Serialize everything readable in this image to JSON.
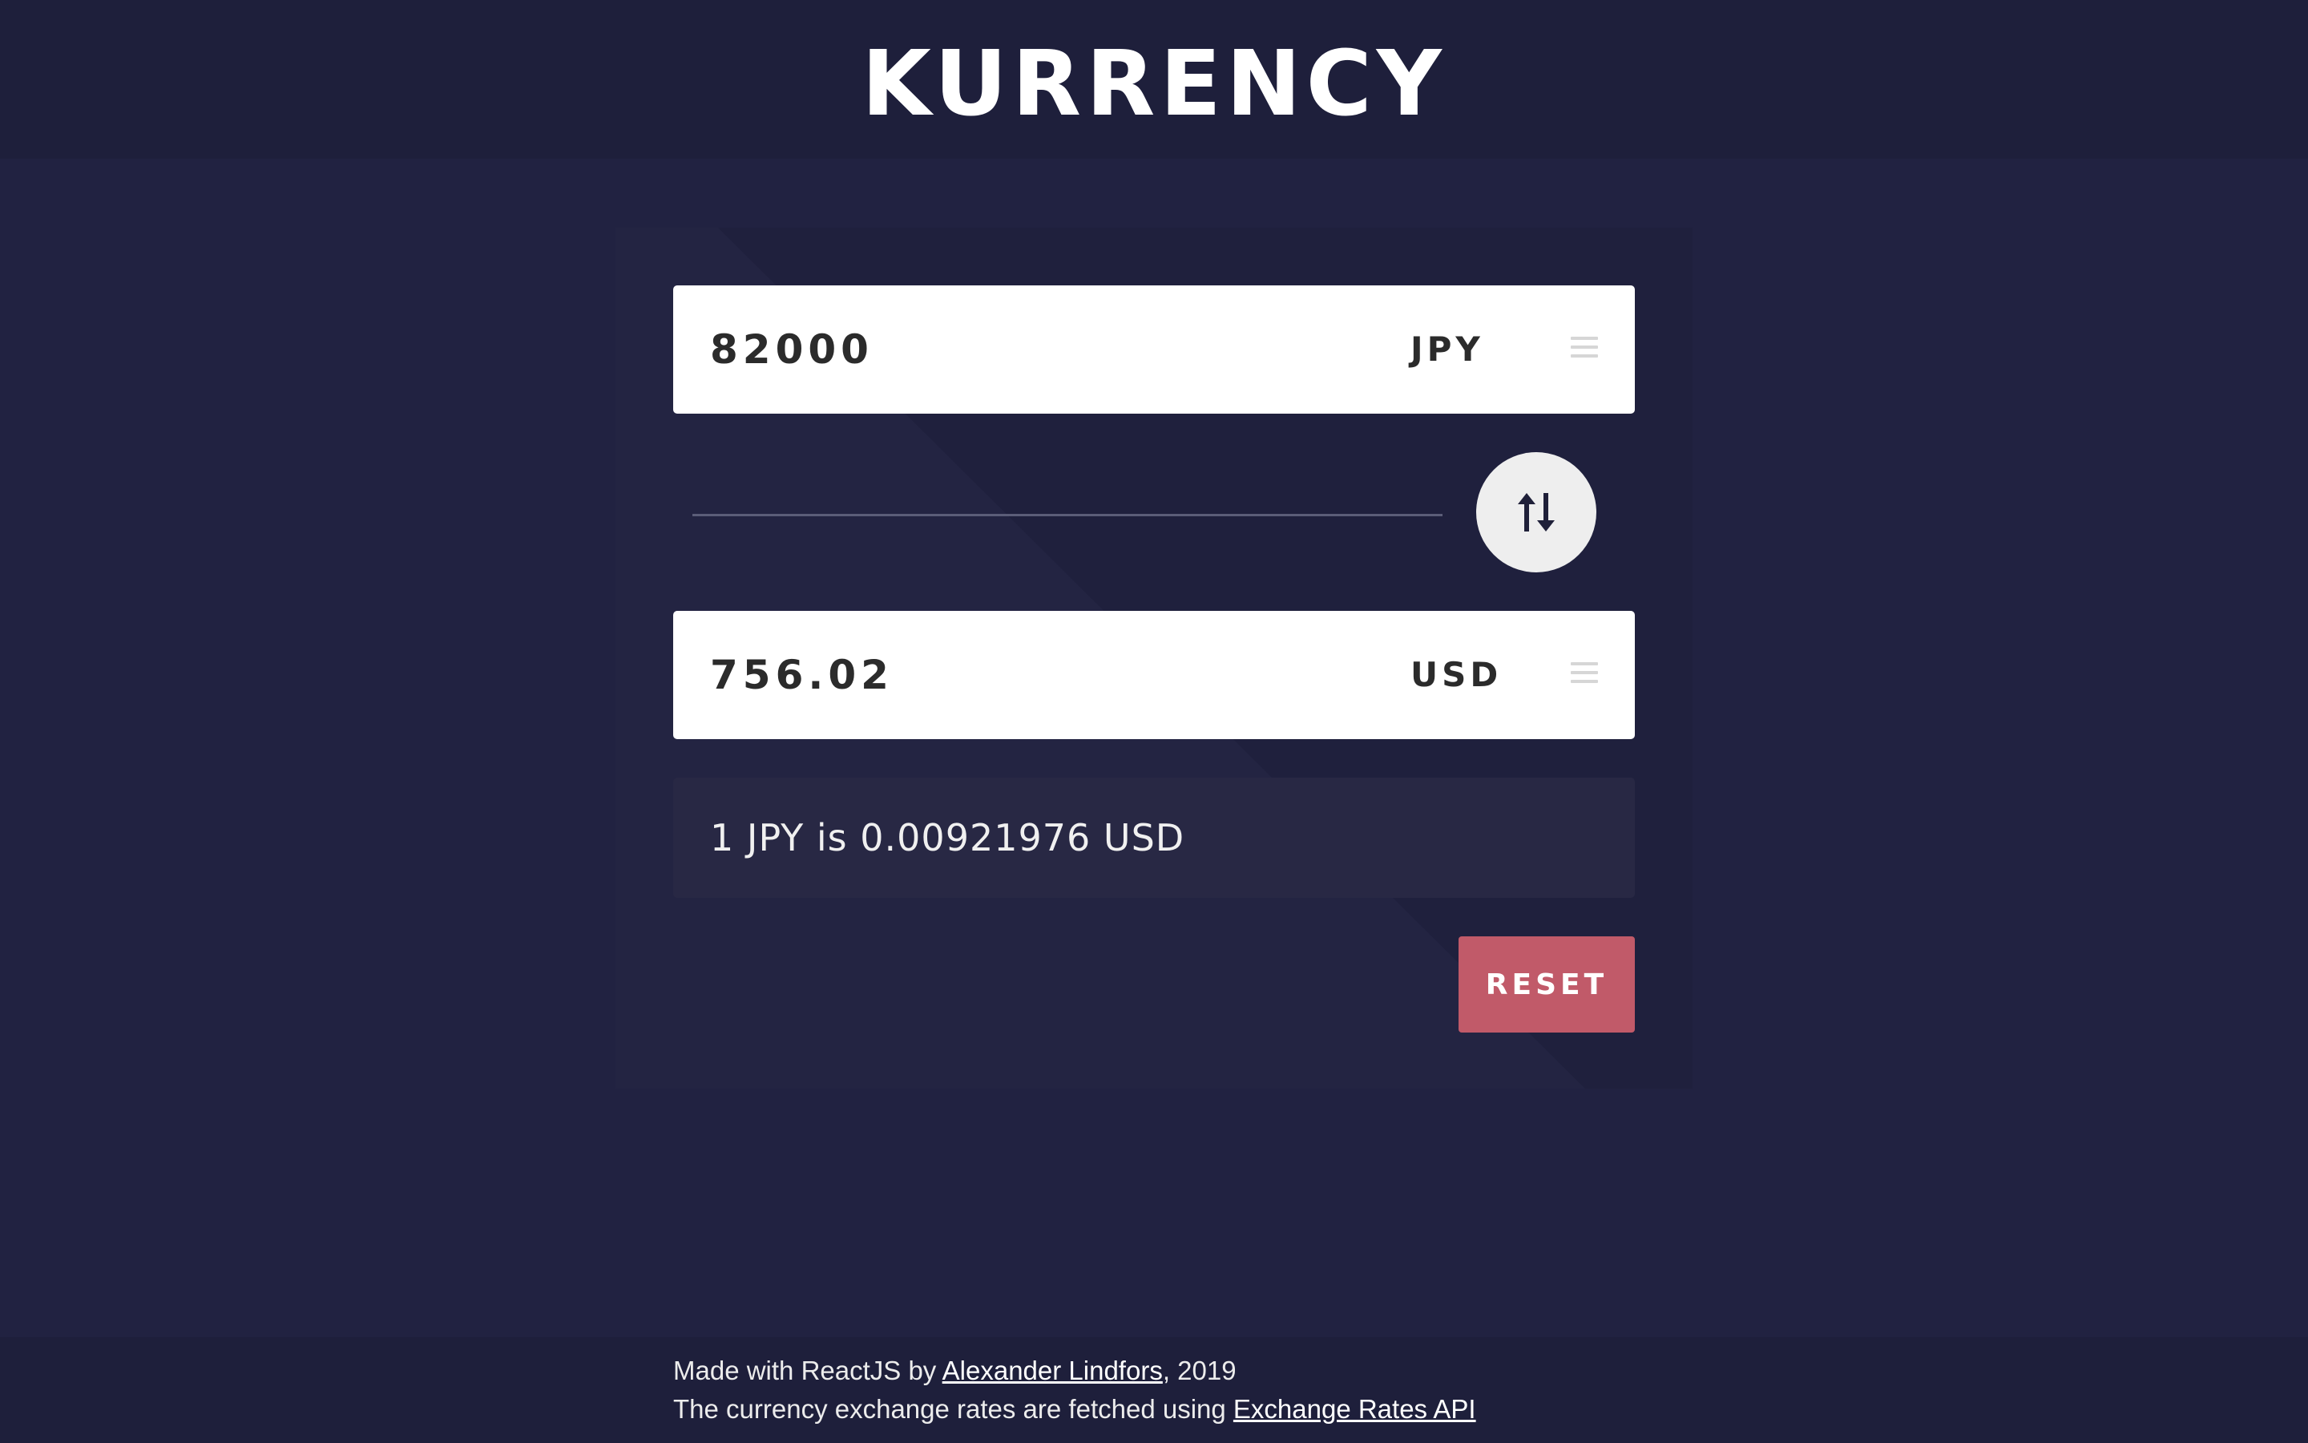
{
  "app": {
    "title": "KURRENCY"
  },
  "converter": {
    "from": {
      "amount": "82000",
      "currency": "JPY"
    },
    "to": {
      "amount": "756.02",
      "currency": "USD"
    },
    "rate_text": "1 JPY is 0.00921976 USD",
    "reset_label": "RESET"
  },
  "footer": {
    "line1_prefix": "Made with ReactJS by ",
    "author_link": "Alexander Lindfors",
    "line1_suffix": ", 2019",
    "line2_prefix": "The currency exchange rates are fetched using ",
    "api_link": "Exchange Rates API"
  },
  "icons": {
    "swap": "swap-vertical-icon",
    "menu": "hamburger-menu-icon"
  },
  "colors": {
    "background": "#212241",
    "panel": "#1f203d",
    "reset_button": "#c15a69",
    "swap_button": "#eeeeee"
  }
}
